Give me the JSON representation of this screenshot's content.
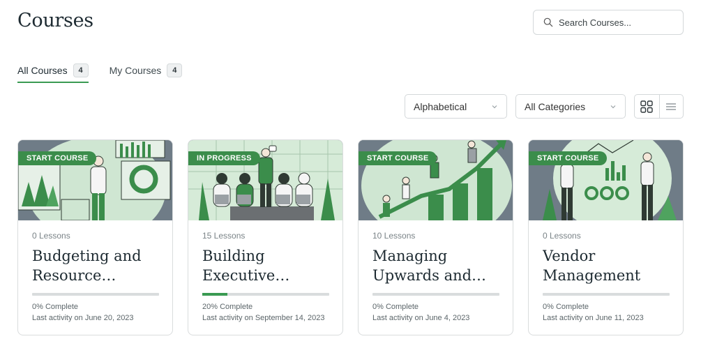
{
  "header": {
    "title": "Courses",
    "search_placeholder": "Search Courses..."
  },
  "tabs": [
    {
      "label": "All Courses",
      "count": "4",
      "active": true
    },
    {
      "label": "My Courses",
      "count": "4",
      "active": false
    }
  ],
  "filters": {
    "sort_value": "Alphabetical",
    "category_value": "All Categories"
  },
  "view": {
    "grid_icon": "grid-icon",
    "list_icon": "list-icon"
  },
  "colors": {
    "accent": "#3a9a52",
    "badge": "#3b8d4b",
    "thumb_bg": "#6d7a85"
  },
  "courses": [
    {
      "badge": "START COURSE",
      "lessons": "0 Lessons",
      "title": "Budgeting and Resource…",
      "progress": 0,
      "progress_text": "0% Complete",
      "last_activity": "Last activity on June 20, 2023"
    },
    {
      "badge": "IN PROGRESS",
      "lessons": "15 Lessons",
      "title": "Building Executive…",
      "progress": 20,
      "progress_text": "20% Complete",
      "last_activity": "Last activity on September 14, 2023"
    },
    {
      "badge": "START COURSE",
      "lessons": "10 Lessons",
      "title": "Managing Upwards and…",
      "progress": 0,
      "progress_text": "0% Complete",
      "last_activity": "Last activity on June 4, 2023"
    },
    {
      "badge": "START COURSE",
      "lessons": "0 Lessons",
      "title": "Vendor Management for…",
      "progress": 0,
      "progress_text": "0% Complete",
      "last_activity": "Last activity on June 11, 2023"
    }
  ]
}
